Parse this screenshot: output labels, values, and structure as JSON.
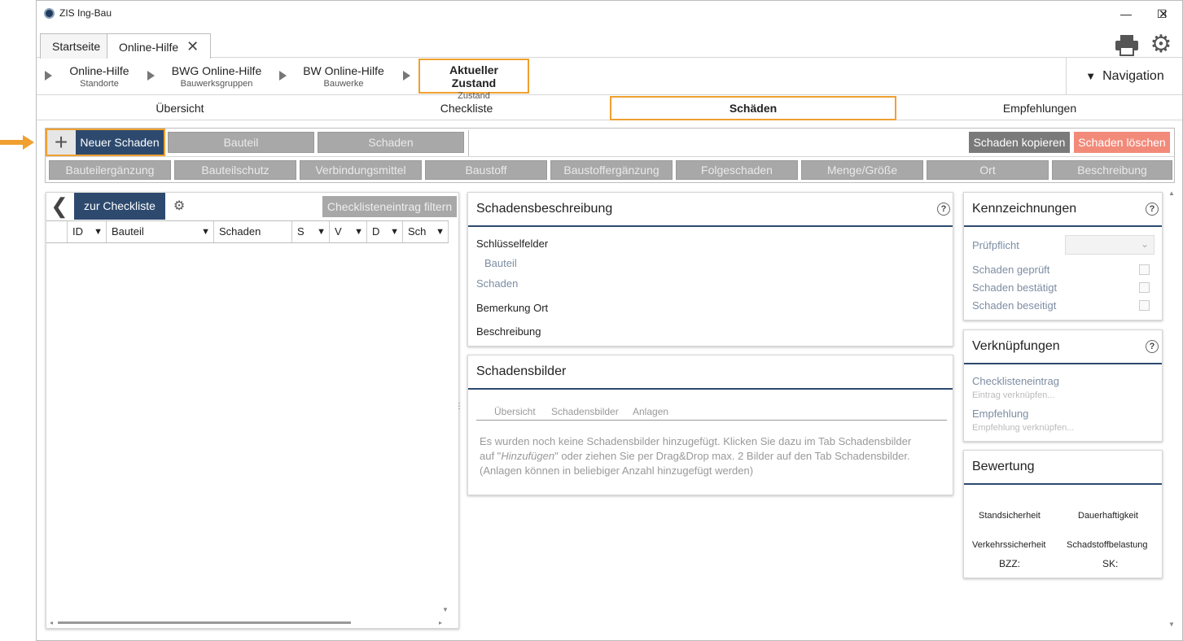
{
  "window": {
    "title": "ZIS Ing-Bau",
    "min": "—",
    "max": "☐",
    "close": "✕"
  },
  "tabs": [
    {
      "label": "Startseite"
    },
    {
      "label": "Online-Hilfe"
    }
  ],
  "breadcrumb": [
    {
      "title": "Online-Hilfe",
      "sub": "Standorte"
    },
    {
      "title": "BWG Online-Hilfe",
      "sub": "Bauwerksgruppen"
    },
    {
      "title": "BW Online-Hilfe",
      "sub": "Bauwerke"
    },
    {
      "title": "Aktueller Zustand",
      "sub": "Zustand"
    }
  ],
  "navigation_label": "Navigation",
  "subtabs": [
    "Übersicht",
    "Checkliste",
    "Schäden",
    "Empfehlungen"
  ],
  "toolbar": {
    "new_damage": "Neuer Schaden",
    "bauteil": "Bauteil",
    "schaden": "Schaden",
    "copy": "Schaden kopieren",
    "delete": "Schaden löschen",
    "row2": [
      "Bauteilergänzung",
      "Bauteilschutz",
      "Verbindungsmittel",
      "Baustoff",
      "Baustoffergänzung",
      "Folgeschaden",
      "Menge/Größe",
      "Ort",
      "Beschreibung"
    ]
  },
  "list": {
    "back_label": "zur Checkliste",
    "filter_label": "Checklisteneintrag filtern",
    "columns": [
      "ID",
      "Bauteil",
      "Schaden",
      "S",
      "V",
      "D",
      "Sch"
    ]
  },
  "beschreibung": {
    "title": "Schadensbeschreibung",
    "key_fields": "Schlüsselfelder",
    "bauteil": "Bauteil",
    "schaden": "Schaden",
    "bemerkung": "Bemerkung Ort",
    "beschreibung": "Beschreibung"
  },
  "bilder": {
    "title": "Schadensbilder",
    "tabs": [
      "Übersicht",
      "Schadensbilder",
      "Anlagen"
    ],
    "text1": "Es wurden noch keine Schadensbilder hinzugefügt. Klicken Sie dazu im Tab Schadensbilder",
    "text2a": "auf \"",
    "text2em": "Hinzufügen",
    "text2b": "\" oder ziehen Sie per Drag&Drop max. 2 Bilder auf den Tab Schadensbilder.",
    "text3": "(Anlagen können in beliebiger Anzahl hinzugefügt werden)"
  },
  "kennzeichnungen": {
    "title": "Kennzeichnungen",
    "pruefpflicht": "Prüfpflicht",
    "geprueft": "Schaden geprüft",
    "bestaetigt": "Schaden bestätigt",
    "beseitigt": "Schaden beseitigt"
  },
  "verknuepfungen": {
    "title": "Verknüpfungen",
    "checkliste": "Checklisteneintrag",
    "checkliste_ph": "Eintrag verknüpfen...",
    "empfehlung": "Empfehlung",
    "empfehlung_ph": "Empfehlung verknüpfen..."
  },
  "bewertung": {
    "title": "Bewertung",
    "standsicherheit": "Standsicherheit",
    "dauerhaftigkeit": "Dauerhaftigkeit",
    "verkehrssicherheit": "Verkehrssicherheit",
    "schadstoff": "Schadstoffbelastung",
    "bzz": "BZZ:",
    "sk": "SK:"
  },
  "help_glyph": "?",
  "colors": {
    "accent": "#2d4a6e",
    "highlight": "#f0a030",
    "danger": "#f28a7a"
  }
}
